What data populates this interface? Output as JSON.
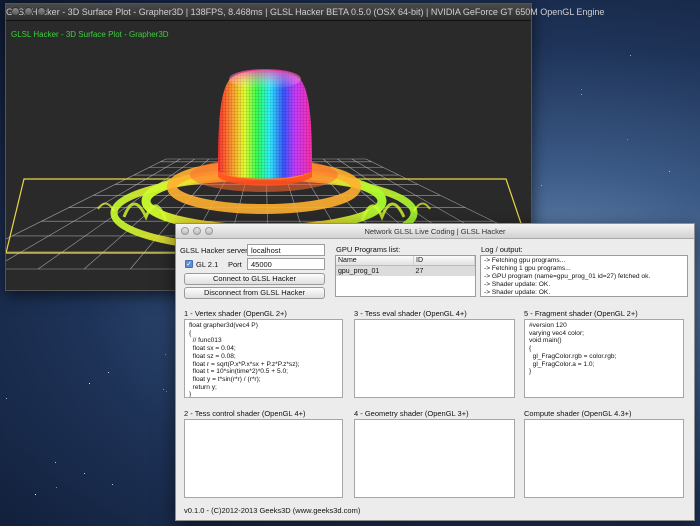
{
  "glsl_window": {
    "title": "GLSL Hacker - 3D Surface Plot - Grapher3D | 138FPS, 8.468ms | GLSL Hacker BETA 0.5.0 (OSX 64-bit) | NVIDIA GeForce GT 650M OpenGL Engine",
    "overlay_text": "GLSL Hacker - 3D Surface Plot - Grapher3D"
  },
  "live_window": {
    "title": "Network GLSL Live Coding | GLSL Hacker",
    "server_label": "GLSL Hacker server",
    "server_value": "localhost",
    "gl_label": "GL 2.1",
    "gl_checked": true,
    "port_label": "Port",
    "port_value": "45000",
    "connect_button": "Connect to GLSL Hacker",
    "disconnect_button": "Disconnect from GLSL Hacker",
    "programs_label": "GPU Programs list:",
    "programs_columns": [
      "Name",
      "ID"
    ],
    "programs_rows": [
      {
        "name": "gpu_prog_01",
        "id": "27"
      }
    ],
    "log_label": "Log / output:",
    "log_lines": [
      "-> Fetching gpu programs...",
      "-> Fetching 1 gpu programs...",
      "-> GPU program (name=gpu_prog_01 id=27) fetched ok.",
      "-> Shader update: OK.",
      "-> Shader update: OK."
    ],
    "shaders": [
      {
        "label": "1 - Vertex shader (OpenGL 2+)",
        "code": "float grapher3d(vec4 P)\n{\n  // func013\n  float sx = 0.04;\n  float sz = 0.08;\n  float r = sqrt(P.x*P.x*sx + P.z*P.z*sz);\n  float t = 10*sin(time*2)*0.5 + 5.0;\n  float y = t*sin(r*r) / (r*r);\n  return y;\n}\n//========================================"
      },
      {
        "label": "3 - Tess eval shader (OpenGL 4+)",
        "code": ""
      },
      {
        "label": "5 - Fragment shader (OpenGL 2+)",
        "code": "#version 120\nvarying vec4 color;\nvoid main()\n{\n  gl_FragColor.rgb = color.rgb;\n  gl_FragColor.a = 1.0;\n}"
      },
      {
        "label": "2 - Tess control shader (OpenGL 4+)",
        "code": ""
      },
      {
        "label": "4 - Geometry shader (OpenGL 3+)",
        "code": ""
      },
      {
        "label": "Compute shader (OpenGL 4.3+)",
        "code": ""
      }
    ],
    "footer": "v0.1.0 - (C)2012-2013 Geeks3D (www.geeks3d.com)"
  },
  "colors": {
    "overlay_green": "#39d13a",
    "grid_yellow": "#e8d84a",
    "viewport_bg": "#2a2a2a"
  }
}
